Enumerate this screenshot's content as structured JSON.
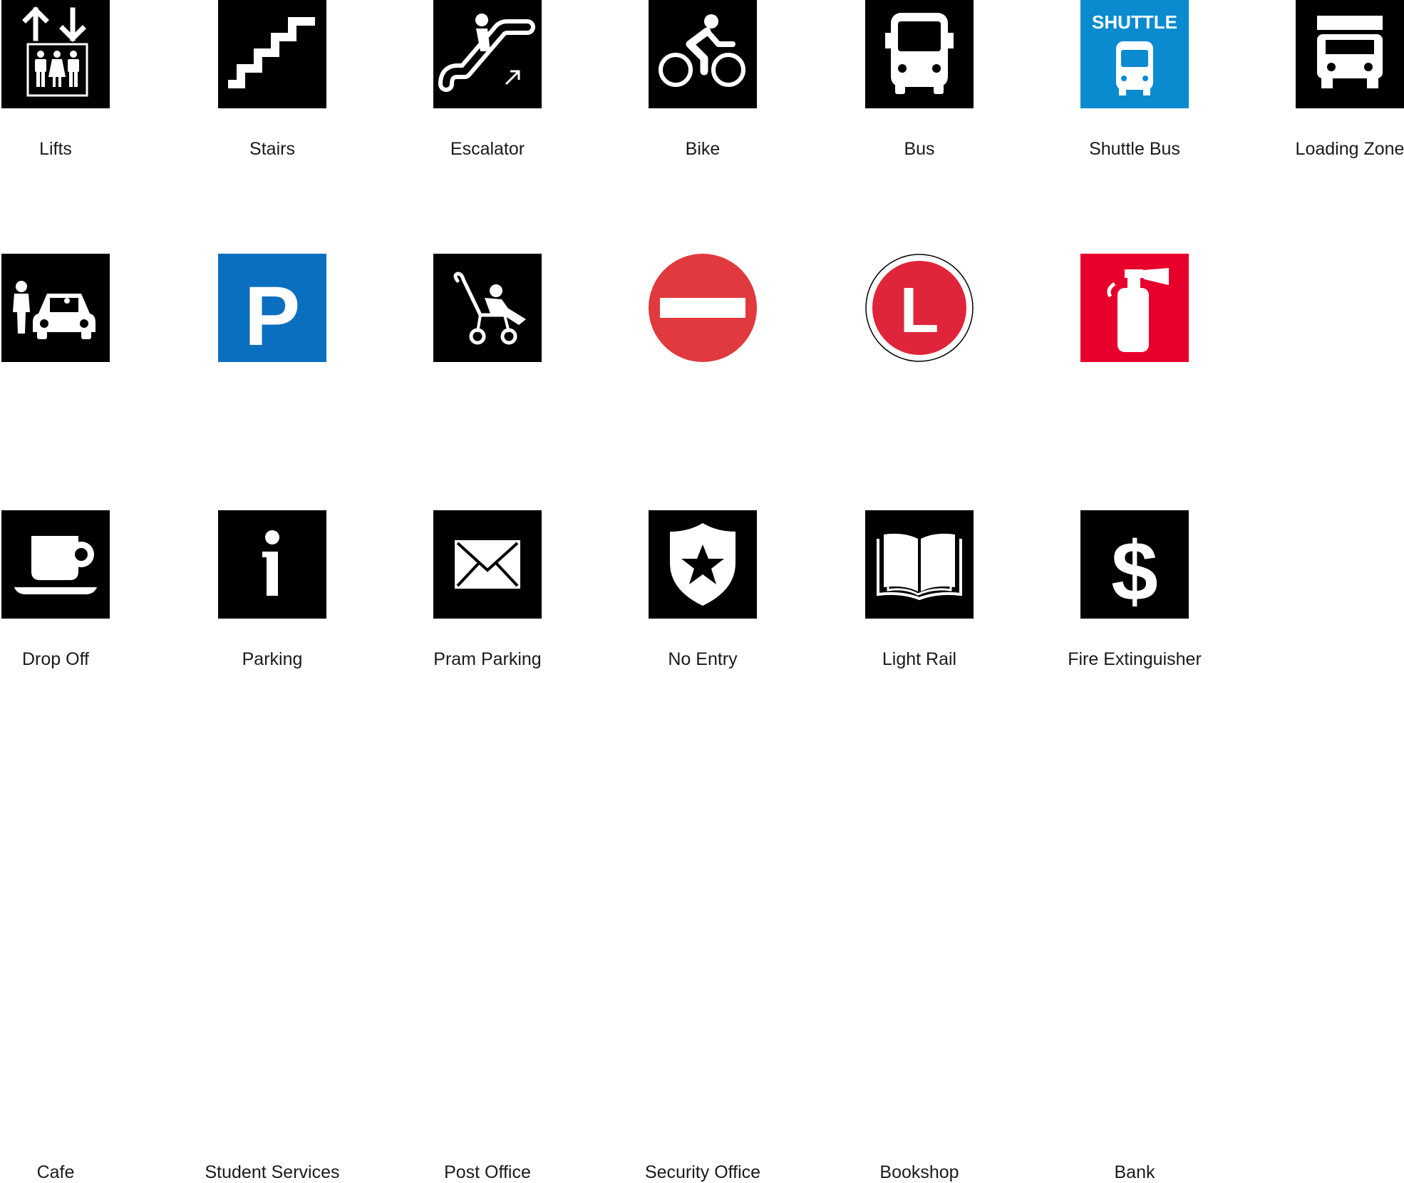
{
  "rows": [
    [
      {
        "label": "Lifts",
        "icon": "lifts-icon",
        "bg": "#000000"
      },
      {
        "label": "Stairs",
        "icon": "stairs-icon",
        "bg": "#000000"
      },
      {
        "label": "Escalator",
        "icon": "escalator-icon",
        "bg": "#000000"
      },
      {
        "label": "Bike",
        "icon": "bike-icon",
        "bg": "#000000"
      },
      {
        "label": "Bus",
        "icon": "bus-icon",
        "bg": "#000000"
      },
      {
        "label": "Shuttle Bus",
        "icon": "shuttle-bus-icon",
        "bg": "#0a8bd0",
        "sign_text": "SHUTTLE"
      },
      {
        "label": "Loading Zone",
        "icon": "truck-icon",
        "bg": "#000000"
      }
    ],
    [
      {
        "label": "Drop Off",
        "icon": "drop-off-icon",
        "bg": "#000000"
      },
      {
        "label": "Parking",
        "icon": "parking-icon",
        "bg": "#0b6fbf",
        "sign_text": "P"
      },
      {
        "label": "Pram Parking",
        "icon": "pram-icon",
        "bg": "#000000"
      },
      {
        "label": "No Entry",
        "icon": "no-entry-icon",
        "bg": "#e03a3e"
      },
      {
        "label": "Light Rail",
        "icon": "light-rail-icon",
        "bg": "#e0243a",
        "sign_text": "L"
      },
      {
        "label": "Fire Extinguisher",
        "icon": "fire-extinguisher-icon",
        "bg": "#e8002d"
      }
    ],
    [
      {
        "label": "Cafe",
        "icon": "coffee-cup-icon",
        "bg": "#000000"
      },
      {
        "label": "Student Services",
        "icon": "info-icon",
        "bg": "#000000",
        "sign_text": "i"
      },
      {
        "label": "Post Office",
        "icon": "envelope-icon",
        "bg": "#000000"
      },
      {
        "label": "Security Office",
        "icon": "shield-star-icon",
        "bg": "#000000"
      },
      {
        "label": "Bookshop",
        "icon": "book-icon",
        "bg": "#000000"
      },
      {
        "label": "Bank",
        "icon": "dollar-icon",
        "bg": "#000000",
        "sign_text": "$"
      }
    ]
  ]
}
